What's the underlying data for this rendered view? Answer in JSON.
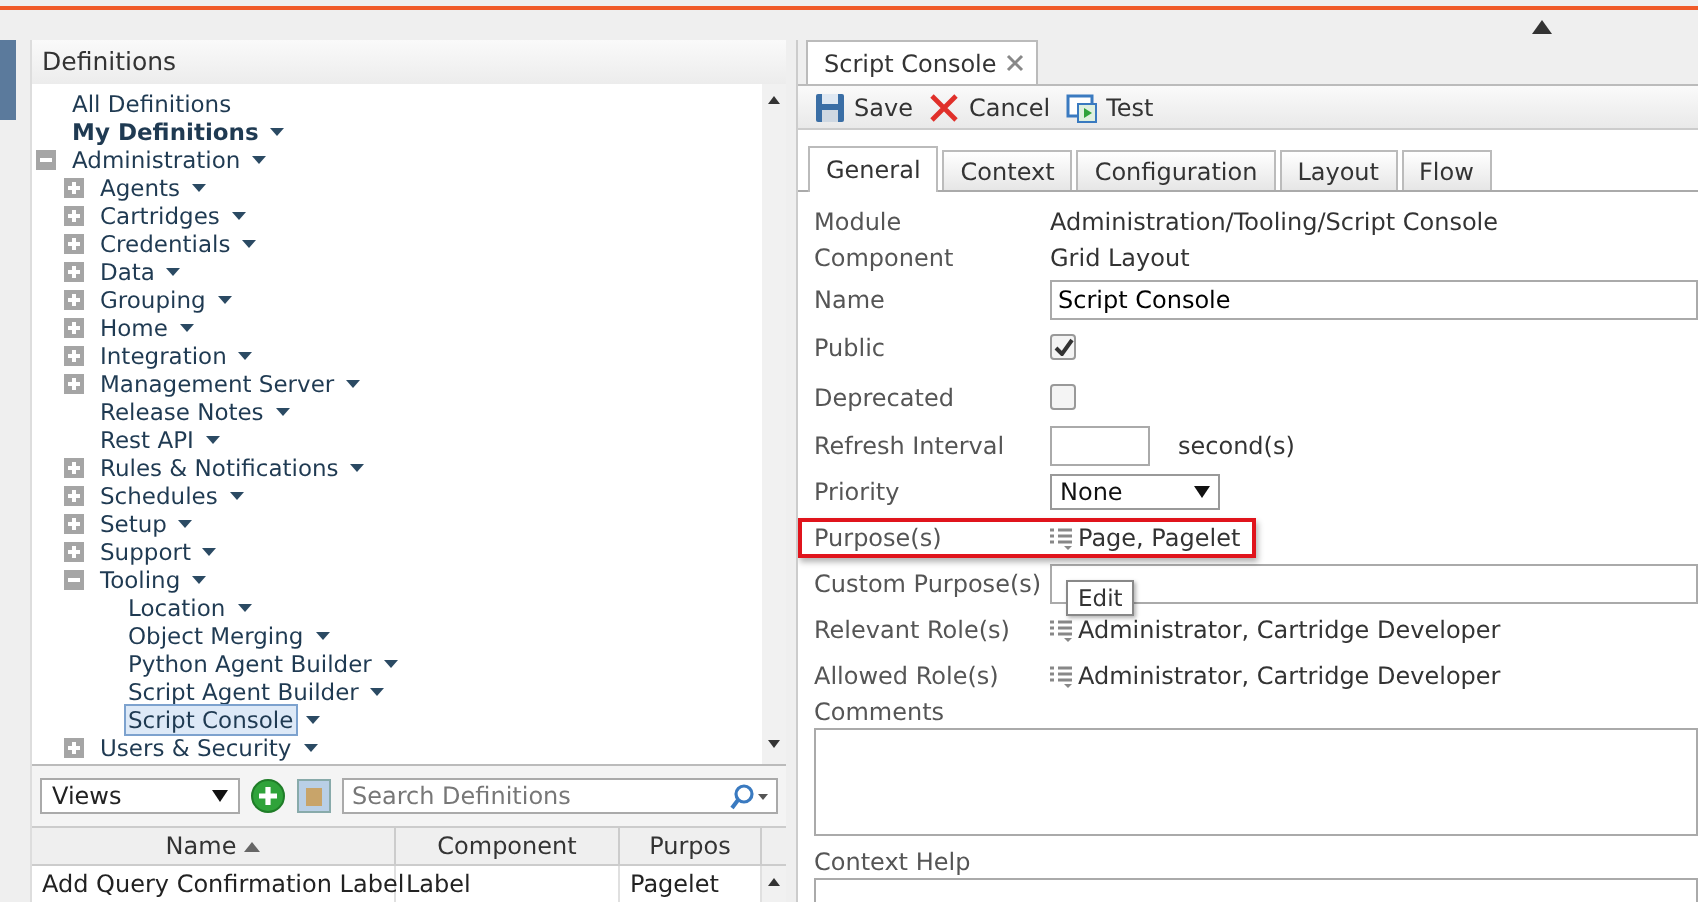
{
  "definitions": {
    "title": "Definitions",
    "tree": [
      {
        "label": "All Definitions",
        "menu": false,
        "bold": false,
        "selected": false
      },
      {
        "label": "My Definitions",
        "menu": true,
        "bold": true,
        "selected": false
      },
      {
        "label": "Administration",
        "menu": true,
        "bold": false,
        "selected": false,
        "expanded": true,
        "children": [
          {
            "label": "Agents",
            "menu": true,
            "selected": false,
            "expanded": false
          },
          {
            "label": "Cartridges",
            "menu": true,
            "selected": false,
            "expanded": false
          },
          {
            "label": "Credentials",
            "menu": true,
            "selected": false,
            "expanded": false
          },
          {
            "label": "Data",
            "menu": true,
            "selected": false,
            "expanded": false
          },
          {
            "label": "Grouping",
            "menu": true,
            "selected": false,
            "expanded": false
          },
          {
            "label": "Home",
            "menu": true,
            "selected": false,
            "expanded": false
          },
          {
            "label": "Integration",
            "menu": true,
            "selected": false,
            "expanded": false
          },
          {
            "label": "Management Server",
            "menu": true,
            "selected": false,
            "expanded": false
          },
          {
            "label": "Release Notes",
            "menu": true,
            "selected": false
          },
          {
            "label": "Rest API",
            "menu": true,
            "selected": false
          },
          {
            "label": "Rules & Notifications",
            "menu": true,
            "selected": false,
            "expanded": false
          },
          {
            "label": "Schedules",
            "menu": true,
            "selected": false,
            "expanded": false
          },
          {
            "label": "Setup",
            "menu": true,
            "selected": false,
            "expanded": false
          },
          {
            "label": "Support",
            "menu": true,
            "selected": false,
            "expanded": false
          },
          {
            "label": "Tooling",
            "menu": true,
            "selected": false,
            "expanded": true,
            "children": [
              {
                "label": "Location",
                "menu": true,
                "selected": false
              },
              {
                "label": "Object Merging",
                "menu": true,
                "selected": false
              },
              {
                "label": "Python Agent Builder",
                "menu": true,
                "selected": false
              },
              {
                "label": "Script Agent Builder",
                "menu": true,
                "selected": false
              },
              {
                "label": "Script Console",
                "menu": true,
                "selected": true
              }
            ]
          },
          {
            "label": "Users & Security",
            "menu": true,
            "selected": false,
            "expanded": false
          }
        ]
      }
    ],
    "views_select": "Views",
    "search": {
      "placeholder": "Search Definitions"
    },
    "table": {
      "columns": [
        {
          "label": "Name",
          "sorted": true
        },
        {
          "label": "Component"
        },
        {
          "label": "Purpos"
        }
      ],
      "rows": [
        [
          "Add Query Confirmation Label",
          "Label",
          "Pagelet"
        ]
      ]
    }
  },
  "editor": {
    "doc_tab": {
      "label": "Script Console"
    },
    "toolbar": [
      {
        "kind": "save",
        "label": "Save"
      },
      {
        "kind": "cancel",
        "label": "Cancel"
      },
      {
        "kind": "test",
        "label": "Test"
      }
    ],
    "tabs": [
      {
        "label": "General",
        "selected": true
      },
      {
        "label": "Context",
        "selected": false
      },
      {
        "label": "Configuration",
        "selected": false
      },
      {
        "label": "Layout",
        "selected": false
      },
      {
        "label": "Flow",
        "selected": false
      }
    ],
    "fields": [
      {
        "kind": "text",
        "label": "Module",
        "value": "Administration/Tooling/Script Console"
      },
      {
        "kind": "text",
        "label": "Component",
        "value": "Grid Layout"
      },
      {
        "kind": "input",
        "label": "Name",
        "value": "Script Console"
      },
      {
        "kind": "checkbox",
        "label": "Public",
        "checked": true
      },
      {
        "kind": "checkbox",
        "label": "Deprecated",
        "checked": false
      },
      {
        "kind": "number",
        "label": "Refresh Interval",
        "unit": "second(s)"
      },
      {
        "kind": "select",
        "label": "Priority",
        "value": "None"
      },
      {
        "kind": "picker",
        "label": "Purpose(s)",
        "value": "Page, Pagelet",
        "highlighted": true
      },
      {
        "kind": "input",
        "label": "Custom Purpose(s)"
      },
      {
        "kind": "picker",
        "label": "Relevant Role(s)",
        "value": "Administrator, Cartridge Developer",
        "highlighted": false
      },
      {
        "kind": "picker",
        "label": "Allowed Role(s)",
        "value": "Administrator, Cartridge Developer",
        "highlighted": false
      },
      {
        "kind": "textarea",
        "label": "Comments"
      },
      {
        "kind": "textarea",
        "label": "Context Help"
      }
    ],
    "tooltip": "Edit"
  }
}
